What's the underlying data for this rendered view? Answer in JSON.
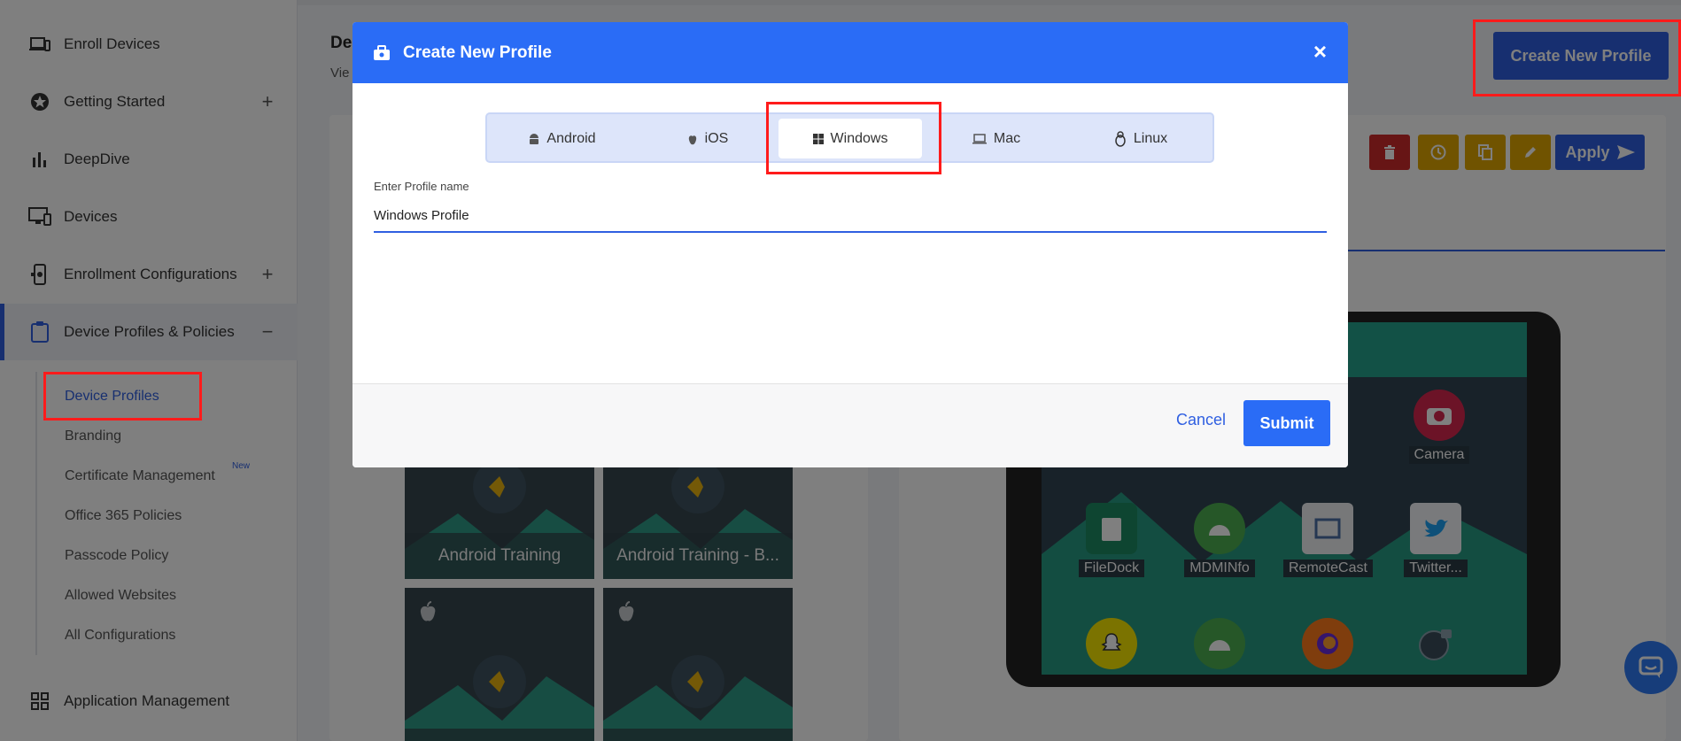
{
  "sidebar": {
    "items": [
      {
        "label": "Enroll Devices",
        "icon": "devices-icon",
        "expand": ""
      },
      {
        "label": "Getting Started",
        "icon": "star-icon",
        "expand": "+"
      },
      {
        "label": "DeepDive",
        "icon": "bar-chart-icon",
        "expand": ""
      },
      {
        "label": "Devices",
        "icon": "monitor-icon",
        "expand": ""
      },
      {
        "label": "Enrollment Configurations",
        "icon": "phone-gear-icon",
        "expand": "+"
      },
      {
        "label": "Device Profiles & Policies",
        "icon": "clipboard-icon",
        "expand": "−"
      },
      {
        "label": "Application Management",
        "icon": "grid-icon",
        "expand": ""
      }
    ],
    "sub_items": [
      {
        "label": "Device Profiles"
      },
      {
        "label": "Branding"
      },
      {
        "label": "Certificate Management"
      },
      {
        "label": "Office 365 Policies"
      },
      {
        "label": "Passcode Policy"
      },
      {
        "label": "Allowed Websites"
      },
      {
        "label": "All Configurations"
      }
    ],
    "new_badge": "New"
  },
  "main": {
    "title_fragment": "De",
    "subtitle_fragment": "Vie",
    "create_button": "Create New Profile",
    "apply_button": "Apply",
    "tiles": [
      {
        "caption": "Android Training"
      },
      {
        "caption": "Android Training - B..."
      },
      {
        "caption": ""
      },
      {
        "caption": ""
      }
    ],
    "apps": [
      {
        "label": "Camera"
      },
      {
        "label": "FileDock"
      },
      {
        "label": "MDMINfo"
      },
      {
        "label": "RemoteCast"
      },
      {
        "label": "Twitter..."
      }
    ]
  },
  "modal": {
    "title": "Create New Profile",
    "close": "×",
    "os_options": [
      {
        "label": "Android"
      },
      {
        "label": "iOS"
      },
      {
        "label": "Windows"
      },
      {
        "label": "Mac"
      },
      {
        "label": "Linux"
      }
    ],
    "selected_os": "Windows",
    "field_label": "Enter Profile name",
    "field_value": "Windows Profile",
    "cancel": "Cancel",
    "submit": "Submit"
  },
  "colors": {
    "primary": "#2a6cf6",
    "highlight": "#ff1b1b",
    "delete": "#cf2b2b",
    "warning": "#e0a600"
  }
}
